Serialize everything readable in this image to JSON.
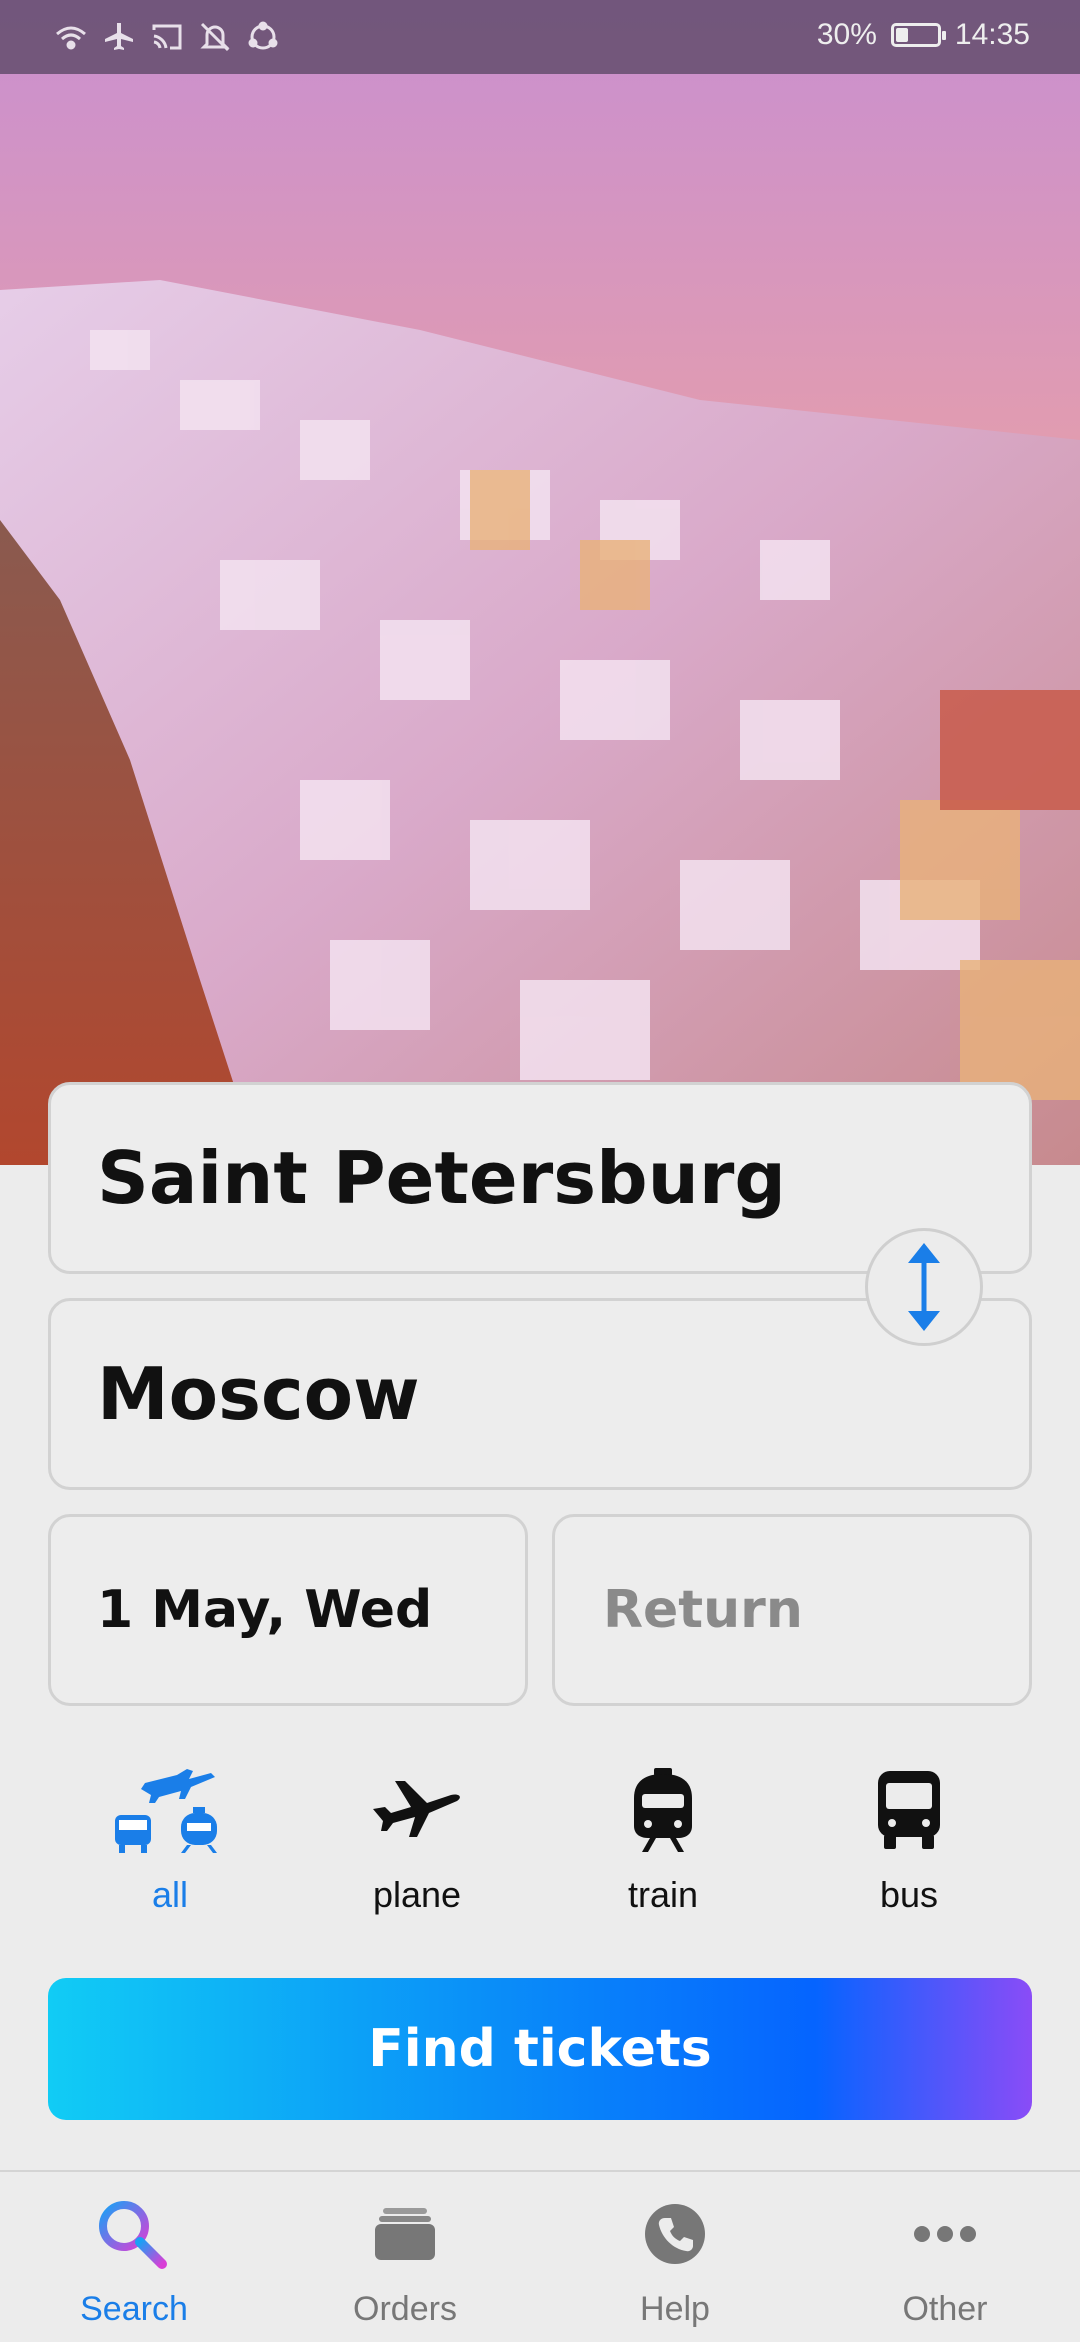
{
  "status_bar": {
    "battery_percent": "30%",
    "battery_level": 0.3,
    "time": "14:35",
    "icons": [
      "wifi-icon",
      "airplane-mode-icon",
      "cast-icon",
      "mute-bell-icon",
      "sync-icon"
    ]
  },
  "search_form": {
    "from_city": "Saint Petersburg",
    "to_city": "Moscow",
    "departure_date": "1 May, Wed",
    "return_placeholder": "Return",
    "swap_icon": "swap-vertical-icon"
  },
  "transport_modes": [
    {
      "label": "all",
      "icon": "all-transport-icon",
      "active": true
    },
    {
      "label": "plane",
      "icon": "plane-icon",
      "active": false
    },
    {
      "label": "train",
      "icon": "train-icon",
      "active": false
    },
    {
      "label": "bus",
      "icon": "bus-icon",
      "active": false
    }
  ],
  "find_button_label": "Find tickets",
  "bottom_nav": [
    {
      "label": "Search",
      "icon": "search-icon",
      "active": true
    },
    {
      "label": "Orders",
      "icon": "orders-icon",
      "active": false
    },
    {
      "label": "Help",
      "icon": "help-phone-icon",
      "active": false
    },
    {
      "label": "Other",
      "icon": "more-icon",
      "active": false
    }
  ],
  "colors": {
    "accent": "#1a7ee8",
    "background": "#ececec",
    "button_gradient": [
      "#11ccf5",
      "#0564ff",
      "#8a4cf7"
    ]
  }
}
